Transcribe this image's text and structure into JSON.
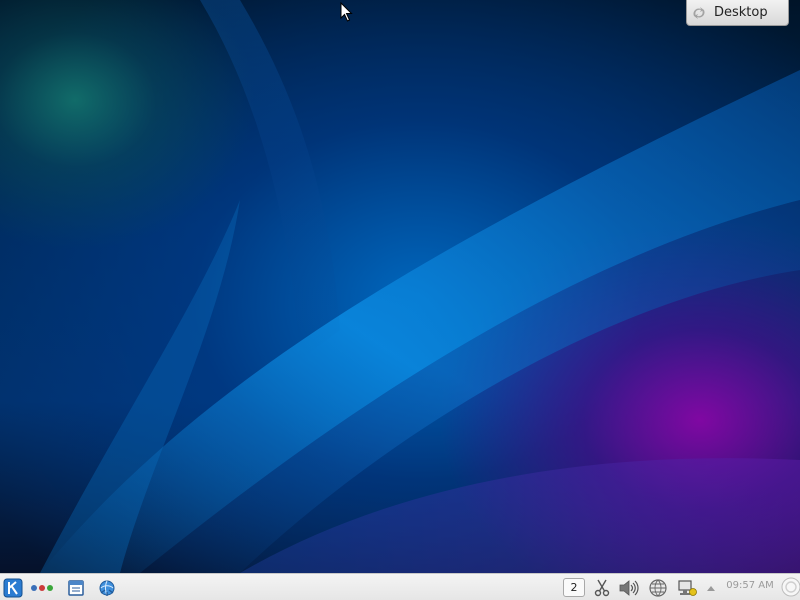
{
  "desktop": {
    "label": "Desktop",
    "colors": {
      "background_dark": "#001428",
      "wave_blue": "#0a7fd6",
      "teal_glow": "#14786e",
      "purple_glow": "#9600aa"
    }
  },
  "panel": {
    "launcher_icon": "kde-k-icon",
    "activities_icon": "activities-dots-icon",
    "task_icons": [
      "file-manager-icon",
      "konqueror-browser-icon"
    ],
    "pager_label": "2",
    "tray_icons": [
      "clipboard-scissors-icon",
      "volume-icon",
      "network-icon",
      "device-notifier-icon",
      "tray-expand-arrow-icon"
    ],
    "clock": "09:57 AM",
    "cashew_icon": "panel-cashew-icon"
  },
  "cursor": {
    "icon": "mouse-pointer-icon"
  }
}
